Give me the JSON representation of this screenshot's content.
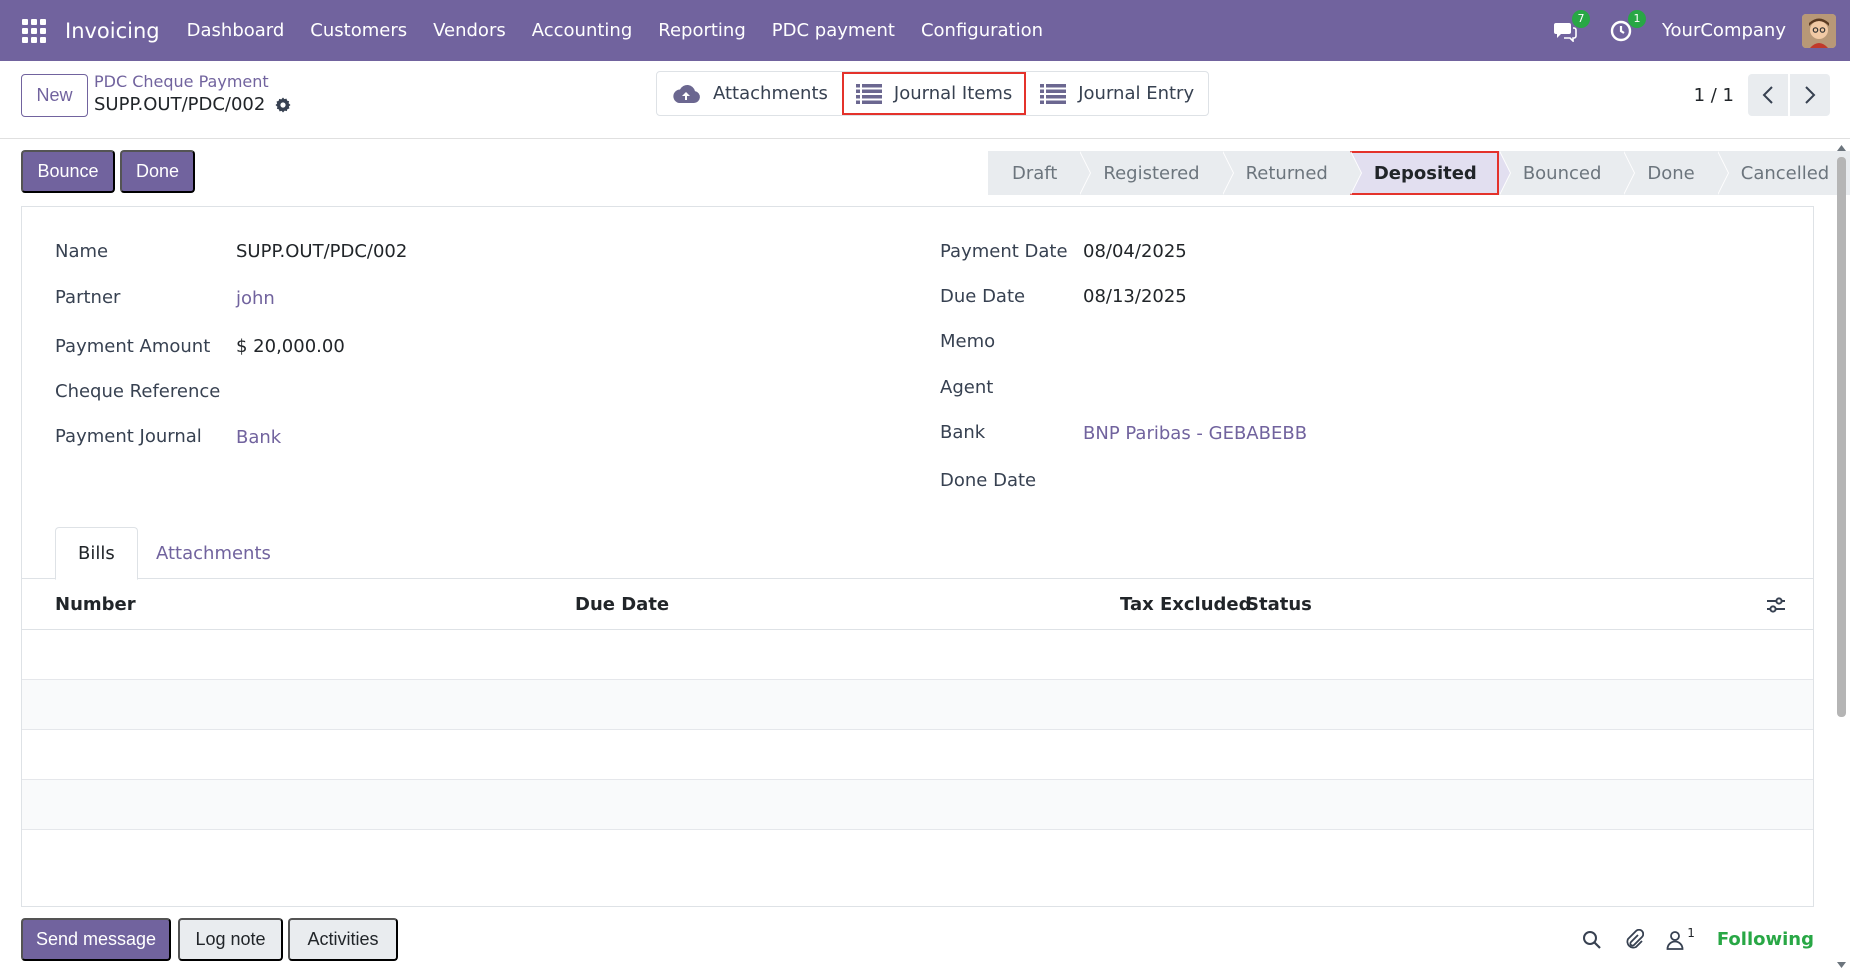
{
  "navbar": {
    "app_name": "Invoicing",
    "menu": [
      "Dashboard",
      "Customers",
      "Vendors",
      "Accounting",
      "Reporting",
      "PDC payment",
      "Configuration"
    ],
    "messages_count": "7",
    "activities_count": "1",
    "company": "YourCompany"
  },
  "control": {
    "new_label": "New",
    "breadcrumb_parent": "PDC Cheque Payment",
    "breadcrumb_current": "SUPP.OUT/PDC/002",
    "smart_buttons": [
      "Attachments",
      "Journal Items",
      "Journal Entry"
    ],
    "pager": "1 / 1"
  },
  "actions": {
    "bounce_label": "Bounce",
    "done_label": "Done"
  },
  "statusbar": {
    "stages": [
      "Draft",
      "Registered",
      "Returned",
      "Deposited",
      "Bounced",
      "Done",
      "Cancelled"
    ],
    "active": "Deposited"
  },
  "form": {
    "left": [
      {
        "label": "Name",
        "value": "SUPP.OUT/PDC/002"
      },
      {
        "label": "Partner",
        "value": "john"
      },
      {
        "label": "Payment Amount",
        "value": "$ 20,000.00"
      },
      {
        "label": "Cheque Reference",
        "value": ""
      },
      {
        "label": "Payment Journal",
        "value": "Bank"
      }
    ],
    "right": [
      {
        "label": "Payment Date",
        "value": "08/04/2025"
      },
      {
        "label": "Due Date",
        "value": "08/13/2025"
      },
      {
        "label": "Memo",
        "value": ""
      },
      {
        "label": "Agent",
        "value": ""
      },
      {
        "label": "Bank",
        "value": "BNP Paribas - GEBABEBB"
      },
      {
        "label": "Done Date",
        "value": ""
      }
    ]
  },
  "tabs": [
    "Bills",
    "Attachments"
  ],
  "bills_table": {
    "columns": [
      "Number",
      "Due Date",
      "Tax Excluded",
      "Status"
    ],
    "rows": []
  },
  "chatter": {
    "send_message": "Send message",
    "log_note": "Log note",
    "activities": "Activities",
    "followers_count": "1",
    "following": "Following"
  },
  "colors": {
    "brand": "#71639e",
    "highlight": "#e4322b",
    "following": "#28a745"
  }
}
